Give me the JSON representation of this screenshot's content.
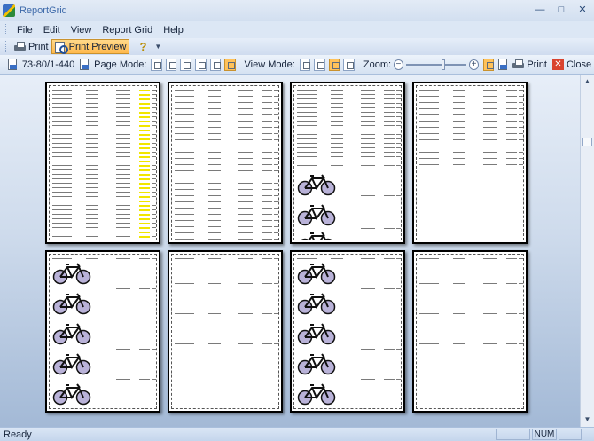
{
  "window": {
    "title": "ReportGrid"
  },
  "menu": [
    "File",
    "Edit",
    "View",
    "Report Grid",
    "Help"
  ],
  "toolbar": {
    "print_label": "Print",
    "print_preview_label": "Print Preview",
    "help_icon": "?"
  },
  "preview_toolbar": {
    "page_range": "73-80/1-440",
    "page_mode_label": "Page Mode:",
    "view_mode_label": "View Mode:",
    "zoom_label": "Zoom:",
    "zoom_minus": "−",
    "zoom_plus": "+",
    "print_label": "Print",
    "close_label": "Close"
  },
  "status": {
    "text": "Ready",
    "num": "NUM"
  },
  "colors": {
    "active_orange": "#ffb94d",
    "preview_bg_top": "#e7eef8",
    "preview_bg_bottom": "#a3b9d6"
  },
  "icons": [
    "app-icon",
    "printer-icon",
    "print-preview-icon",
    "help-icon",
    "page-setup-icon",
    "page-mode-icon",
    "view-mode-icon",
    "zoom-minus-icon",
    "zoom-plus-icon",
    "close-icon",
    "bicycle-icon"
  ]
}
